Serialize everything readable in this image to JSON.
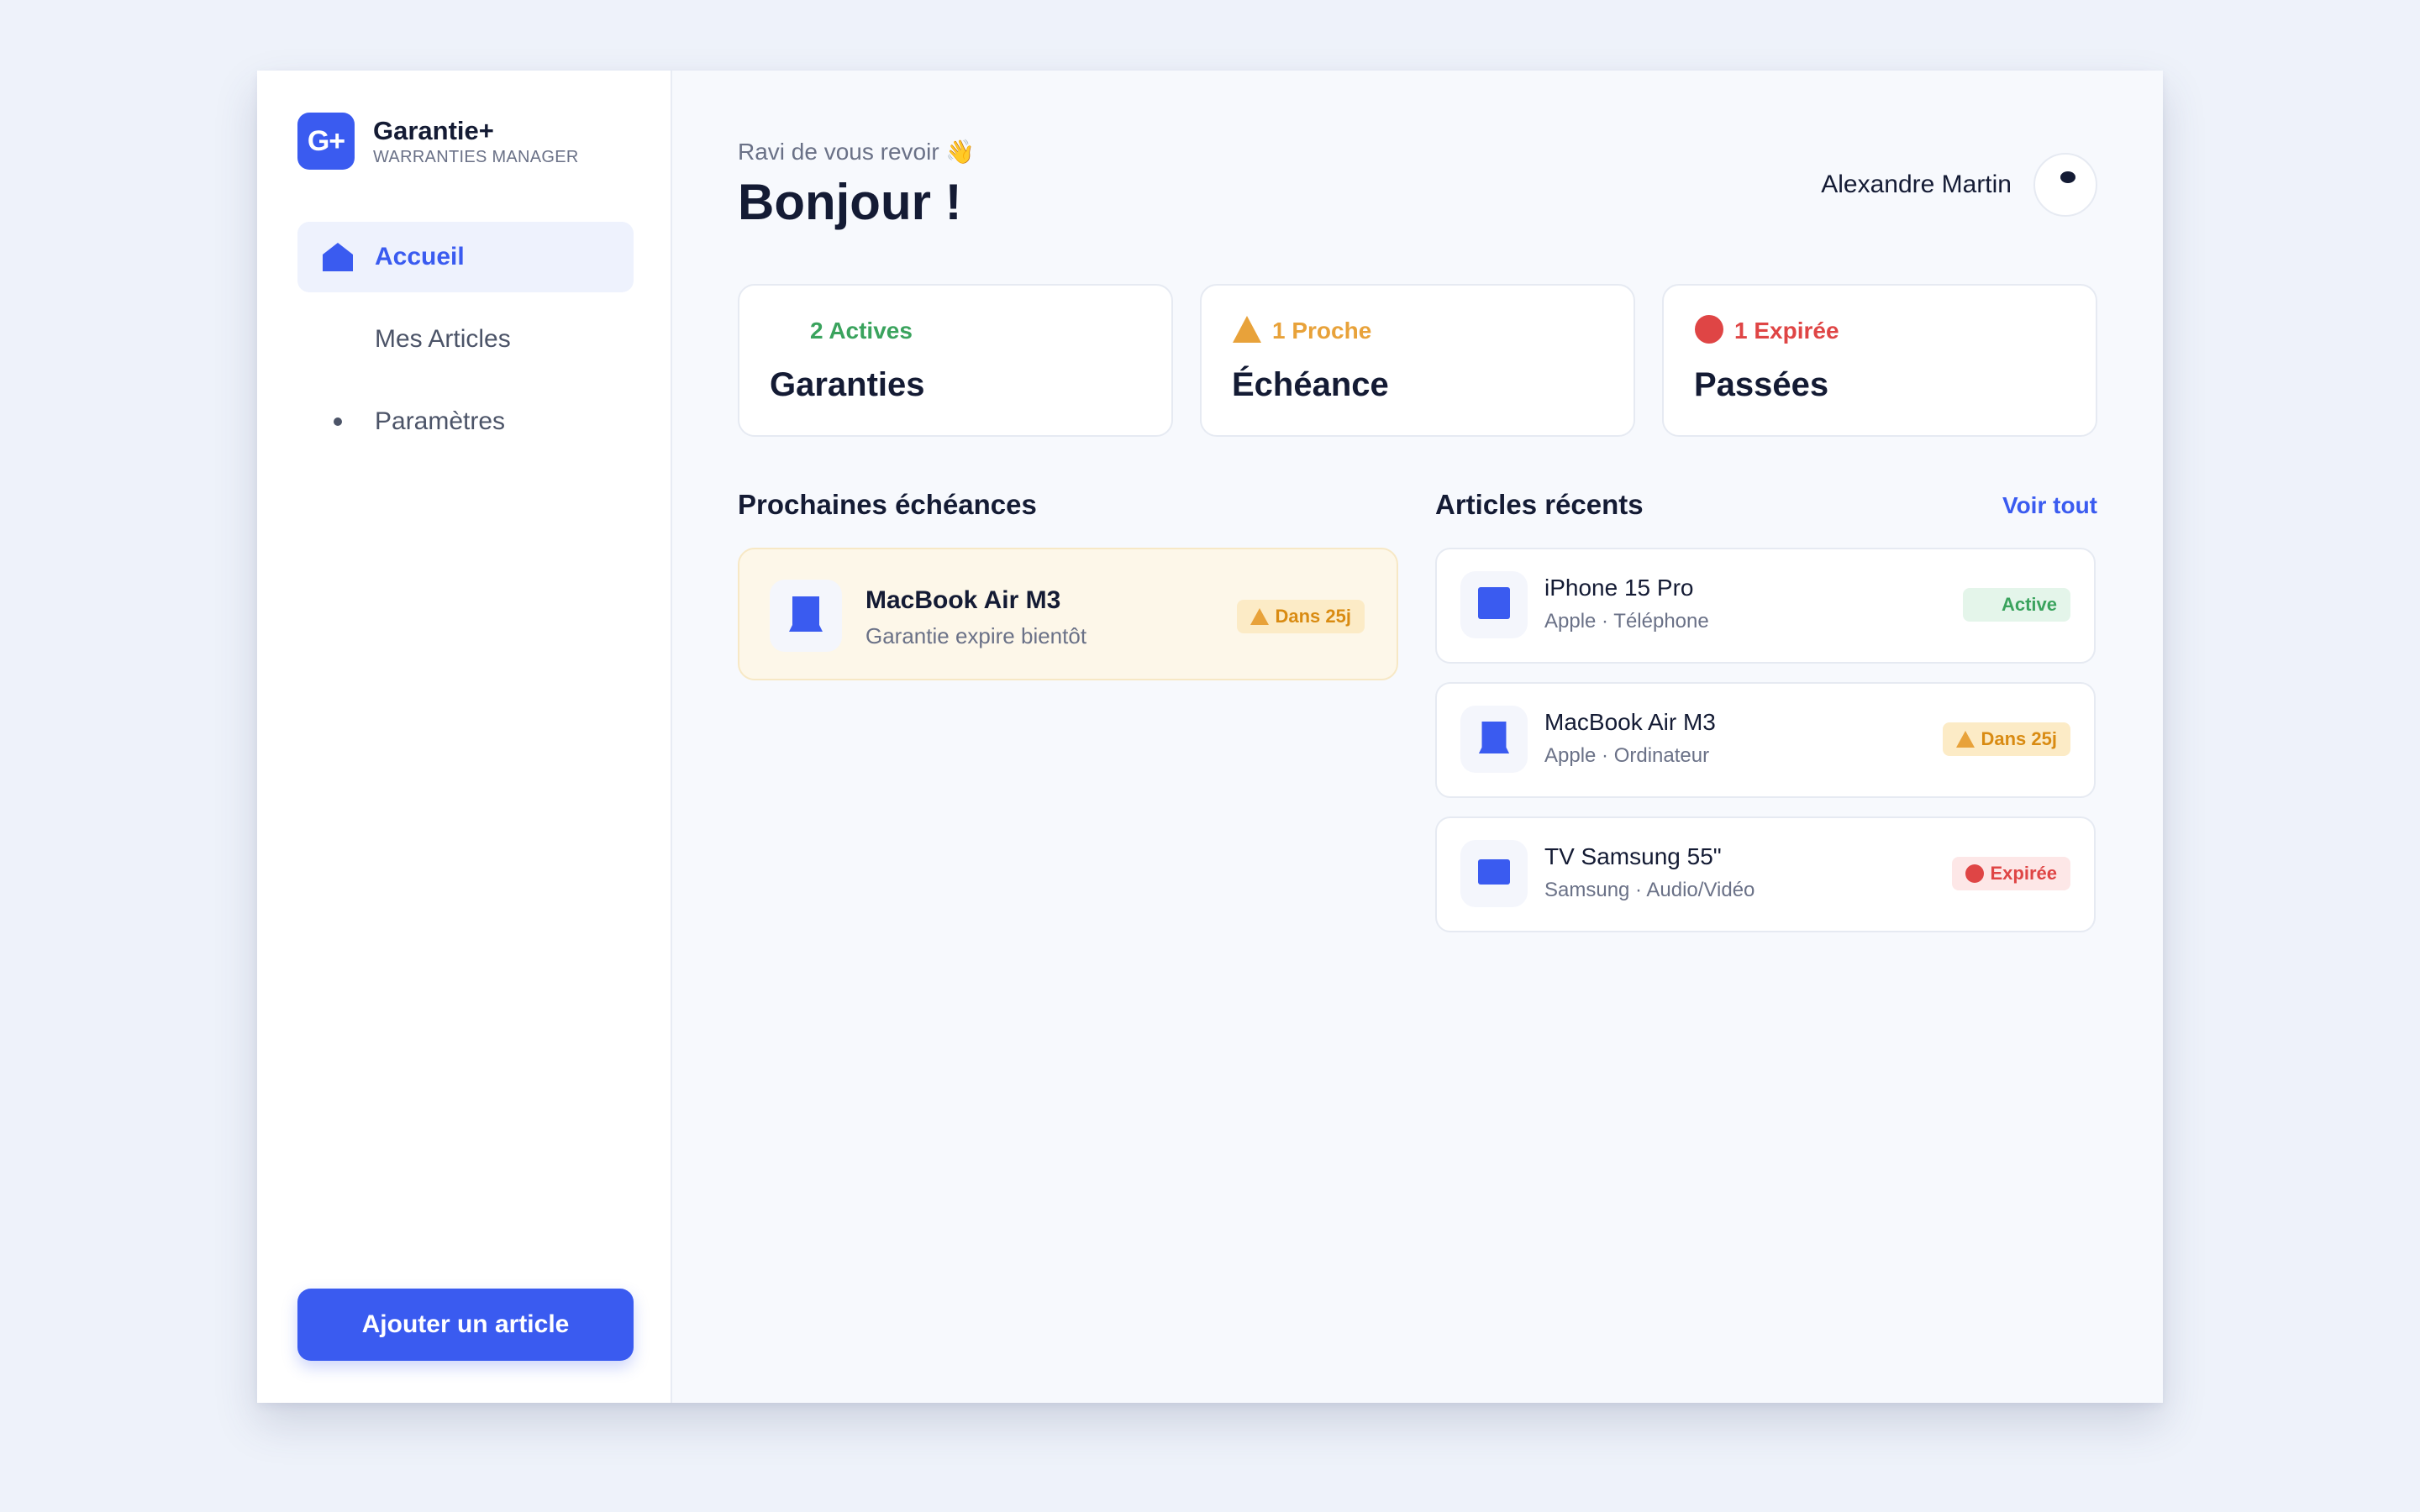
{
  "brand": {
    "logo_text": "G+",
    "name": "Garantie+",
    "subtitle": "WARRANTIES MANAGER"
  },
  "sidebar": {
    "items": [
      {
        "label": "Accueil",
        "icon": "home-icon",
        "active": true
      },
      {
        "label": "Mes Articles",
        "icon": "",
        "active": false
      },
      {
        "label": "Paramètres",
        "icon": "dot-icon",
        "active": false
      }
    ],
    "add_button": "Ajouter un article"
  },
  "header": {
    "welcome": "Ravi de vous revoir 👋",
    "greeting": "Bonjour !",
    "user_name": "Alexandre Martin"
  },
  "stats": [
    {
      "count_label": "2 Actives",
      "label": "Garanties",
      "color": "#3aa35d",
      "icon": ""
    },
    {
      "count_label": "1 Proche",
      "label": "Échéance",
      "color": "#e8a23a",
      "icon": "warning-triangle-icon"
    },
    {
      "count_label": "1 Expirée",
      "label": "Passées",
      "color": "#df4545",
      "icon": "red-circle-icon"
    }
  ],
  "upcoming": {
    "title": "Prochaines échéances",
    "items": [
      {
        "name": "MacBook Air M3",
        "subtitle": "Garantie expire bientôt",
        "badge": "Dans 25j",
        "icon": "laptop-icon"
      }
    ]
  },
  "recent": {
    "title": "Articles récents",
    "see_all": "Voir tout",
    "items": [
      {
        "name": "iPhone 15 Pro",
        "subtitle": "Apple · Téléphone",
        "badge": "Active",
        "status": "ok",
        "icon": "phone-icon"
      },
      {
        "name": "MacBook Air M3",
        "subtitle": "Apple · Ordinateur",
        "badge": "Dans 25j",
        "status": "warn",
        "icon": "laptop-icon"
      },
      {
        "name": "TV Samsung 55\"",
        "subtitle": "Samsung · Audio/Vidéo",
        "badge": "Expirée",
        "status": "exp",
        "icon": "tv-icon"
      }
    ]
  },
  "colors": {
    "accent": "#3a5bf0",
    "active": "#3aa35d",
    "warning": "#e8a23a",
    "expired": "#df4545"
  }
}
